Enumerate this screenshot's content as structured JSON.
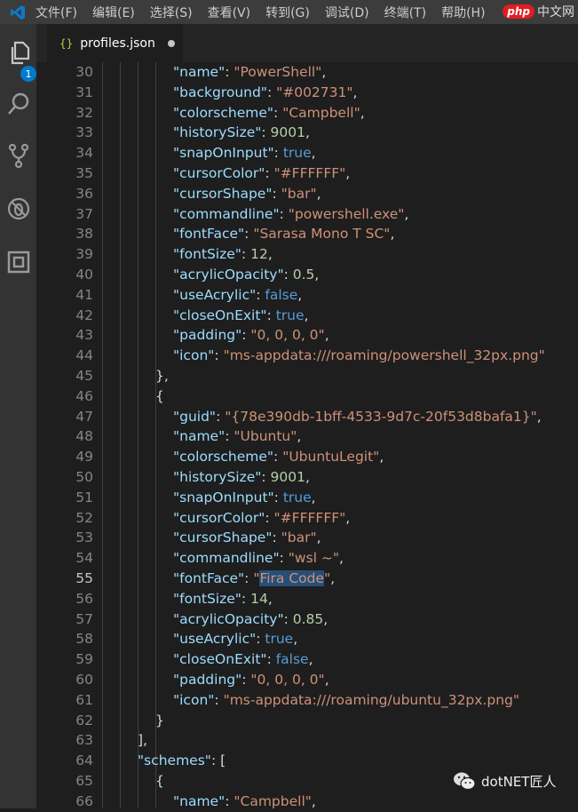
{
  "menubar": {
    "items": [
      "文件(F)",
      "编辑(E)",
      "选择(S)",
      "查看(V)",
      "转到(G)",
      "调试(D)",
      "终端(T)",
      "帮助(H)"
    ],
    "watermark": "中文网",
    "watermark_logo": "php"
  },
  "activity": {
    "badge": "1"
  },
  "tab": {
    "icon": "{}",
    "title": "profiles.json"
  },
  "current_line": 55,
  "lines": [
    {
      "n": 30,
      "i": 4,
      "t": [
        [
          "k",
          "\"name\""
        ],
        [
          "p",
          ": "
        ],
        [
          "s",
          "\"PowerShell\""
        ],
        [
          "p",
          ","
        ]
      ]
    },
    {
      "n": 31,
      "i": 4,
      "t": [
        [
          "k",
          "\"background\""
        ],
        [
          "p",
          ": "
        ],
        [
          "s",
          "\"#002731\""
        ],
        [
          "p",
          ","
        ]
      ]
    },
    {
      "n": 32,
      "i": 4,
      "t": [
        [
          "k",
          "\"colorscheme\""
        ],
        [
          "p",
          ": "
        ],
        [
          "s",
          "\"Campbell\""
        ],
        [
          "p",
          ","
        ]
      ]
    },
    {
      "n": 33,
      "i": 4,
      "t": [
        [
          "k",
          "\"historySize\""
        ],
        [
          "p",
          ": "
        ],
        [
          "n",
          "9001"
        ],
        [
          "p",
          ","
        ]
      ]
    },
    {
      "n": 34,
      "i": 4,
      "t": [
        [
          "k",
          "\"snapOnInput\""
        ],
        [
          "p",
          ": "
        ],
        [
          "b",
          "true"
        ],
        [
          "p",
          ","
        ]
      ]
    },
    {
      "n": 35,
      "i": 4,
      "t": [
        [
          "k",
          "\"cursorColor\""
        ],
        [
          "p",
          ": "
        ],
        [
          "s",
          "\"#FFFFFF\""
        ],
        [
          "p",
          ","
        ]
      ]
    },
    {
      "n": 36,
      "i": 4,
      "t": [
        [
          "k",
          "\"cursorShape\""
        ],
        [
          "p",
          ": "
        ],
        [
          "s",
          "\"bar\""
        ],
        [
          "p",
          ","
        ]
      ]
    },
    {
      "n": 37,
      "i": 4,
      "t": [
        [
          "k",
          "\"commandline\""
        ],
        [
          "p",
          ": "
        ],
        [
          "s",
          "\"powershell.exe\""
        ],
        [
          "p",
          ","
        ]
      ]
    },
    {
      "n": 38,
      "i": 4,
      "t": [
        [
          "k",
          "\"fontFace\""
        ],
        [
          "p",
          ": "
        ],
        [
          "s",
          "\"Sarasa Mono T SC\""
        ],
        [
          "p",
          ","
        ]
      ]
    },
    {
      "n": 39,
      "i": 4,
      "t": [
        [
          "k",
          "\"fontSize\""
        ],
        [
          "p",
          ": "
        ],
        [
          "n",
          "12"
        ],
        [
          "p",
          ","
        ]
      ]
    },
    {
      "n": 40,
      "i": 4,
      "t": [
        [
          "k",
          "\"acrylicOpacity\""
        ],
        [
          "p",
          ": "
        ],
        [
          "n",
          "0.5"
        ],
        [
          "p",
          ","
        ]
      ]
    },
    {
      "n": 41,
      "i": 4,
      "t": [
        [
          "k",
          "\"useAcrylic\""
        ],
        [
          "p",
          ": "
        ],
        [
          "b",
          "false"
        ],
        [
          "p",
          ","
        ]
      ]
    },
    {
      "n": 42,
      "i": 4,
      "t": [
        [
          "k",
          "\"closeOnExit\""
        ],
        [
          "p",
          ": "
        ],
        [
          "b",
          "true"
        ],
        [
          "p",
          ","
        ]
      ]
    },
    {
      "n": 43,
      "i": 4,
      "t": [
        [
          "k",
          "\"padding\""
        ],
        [
          "p",
          ": "
        ],
        [
          "s",
          "\"0, 0, 0, 0\""
        ],
        [
          "p",
          ","
        ]
      ]
    },
    {
      "n": 44,
      "i": 4,
      "t": [
        [
          "k",
          "\"icon\""
        ],
        [
          "p",
          ": "
        ],
        [
          "s",
          "\"ms-appdata:///roaming/powershell_32px.png\""
        ]
      ]
    },
    {
      "n": 45,
      "i": 3,
      "t": [
        [
          "p",
          "},"
        ]
      ]
    },
    {
      "n": 46,
      "i": 3,
      "t": [
        [
          "p",
          "{"
        ]
      ]
    },
    {
      "n": 47,
      "i": 4,
      "t": [
        [
          "k",
          "\"guid\""
        ],
        [
          "p",
          ": "
        ],
        [
          "s",
          "\"{78e390db-1bff-4533-9d7c-20f53d8bafa1}\""
        ],
        [
          "p",
          ","
        ]
      ]
    },
    {
      "n": 48,
      "i": 4,
      "t": [
        [
          "k",
          "\"name\""
        ],
        [
          "p",
          ": "
        ],
        [
          "s",
          "\"Ubuntu\""
        ],
        [
          "p",
          ","
        ]
      ]
    },
    {
      "n": 49,
      "i": 4,
      "t": [
        [
          "k",
          "\"colorscheme\""
        ],
        [
          "p",
          ": "
        ],
        [
          "s",
          "\"UbuntuLegit\""
        ],
        [
          "p",
          ","
        ]
      ]
    },
    {
      "n": 50,
      "i": 4,
      "t": [
        [
          "k",
          "\"historySize\""
        ],
        [
          "p",
          ": "
        ],
        [
          "n",
          "9001"
        ],
        [
          "p",
          ","
        ]
      ]
    },
    {
      "n": 51,
      "i": 4,
      "t": [
        [
          "k",
          "\"snapOnInput\""
        ],
        [
          "p",
          ": "
        ],
        [
          "b",
          "true"
        ],
        [
          "p",
          ","
        ]
      ]
    },
    {
      "n": 52,
      "i": 4,
      "t": [
        [
          "k",
          "\"cursorColor\""
        ],
        [
          "p",
          ": "
        ],
        [
          "s",
          "\"#FFFFFF\""
        ],
        [
          "p",
          ","
        ]
      ]
    },
    {
      "n": 53,
      "i": 4,
      "t": [
        [
          "k",
          "\"cursorShape\""
        ],
        [
          "p",
          ": "
        ],
        [
          "s",
          "\"bar\""
        ],
        [
          "p",
          ","
        ]
      ]
    },
    {
      "n": 54,
      "i": 4,
      "t": [
        [
          "k",
          "\"commandline\""
        ],
        [
          "p",
          ": "
        ],
        [
          "s",
          "\"wsl ~\""
        ],
        [
          "p",
          ","
        ]
      ]
    },
    {
      "n": 55,
      "i": 4,
      "t": [
        [
          "k",
          "\"fontFace\""
        ],
        [
          "p",
          ": "
        ],
        [
          "s",
          "\""
        ],
        [
          "sel",
          "Fira Code"
        ],
        [
          "s",
          "\""
        ],
        [
          "p",
          ","
        ]
      ]
    },
    {
      "n": 56,
      "i": 4,
      "t": [
        [
          "k",
          "\"fontSize\""
        ],
        [
          "p",
          ": "
        ],
        [
          "n",
          "14"
        ],
        [
          "p",
          ","
        ]
      ]
    },
    {
      "n": 57,
      "i": 4,
      "t": [
        [
          "k",
          "\"acrylicOpacity\""
        ],
        [
          "p",
          ": "
        ],
        [
          "n",
          "0.85"
        ],
        [
          "p",
          ","
        ]
      ]
    },
    {
      "n": 58,
      "i": 4,
      "t": [
        [
          "k",
          "\"useAcrylic\""
        ],
        [
          "p",
          ": "
        ],
        [
          "b",
          "true"
        ],
        [
          "p",
          ","
        ]
      ]
    },
    {
      "n": 59,
      "i": 4,
      "t": [
        [
          "k",
          "\"closeOnExit\""
        ],
        [
          "p",
          ": "
        ],
        [
          "b",
          "false"
        ],
        [
          "p",
          ","
        ]
      ]
    },
    {
      "n": 60,
      "i": 4,
      "t": [
        [
          "k",
          "\"padding\""
        ],
        [
          "p",
          ": "
        ],
        [
          "s",
          "\"0, 0, 0, 0\""
        ],
        [
          "p",
          ","
        ]
      ]
    },
    {
      "n": 61,
      "i": 4,
      "t": [
        [
          "k",
          "\"icon\""
        ],
        [
          "p",
          ": "
        ],
        [
          "s",
          "\"ms-appdata:///roaming/ubuntu_32px.png\""
        ]
      ]
    },
    {
      "n": 62,
      "i": 3,
      "t": [
        [
          "p",
          "}"
        ]
      ]
    },
    {
      "n": 63,
      "i": 2,
      "t": [
        [
          "p",
          "],"
        ]
      ]
    },
    {
      "n": 64,
      "i": 2,
      "t": [
        [
          "k",
          "\"schemes\""
        ],
        [
          "p",
          ": ["
        ]
      ]
    },
    {
      "n": 65,
      "i": 3,
      "t": [
        [
          "p",
          "{"
        ]
      ]
    },
    {
      "n": 66,
      "i": 4,
      "t": [
        [
          "k",
          "\"name\""
        ],
        [
          "p",
          ": "
        ],
        [
          "s",
          "\"Campbell\""
        ],
        [
          "p",
          ","
        ]
      ]
    }
  ],
  "watermark_footer": "dotNET匠人",
  "colors": {
    "key": "#9cdcfe",
    "string": "#ce9178",
    "number": "#b5cea8",
    "boolean": "#569cd6",
    "selection": "#264f78",
    "accent": "#007acc"
  }
}
